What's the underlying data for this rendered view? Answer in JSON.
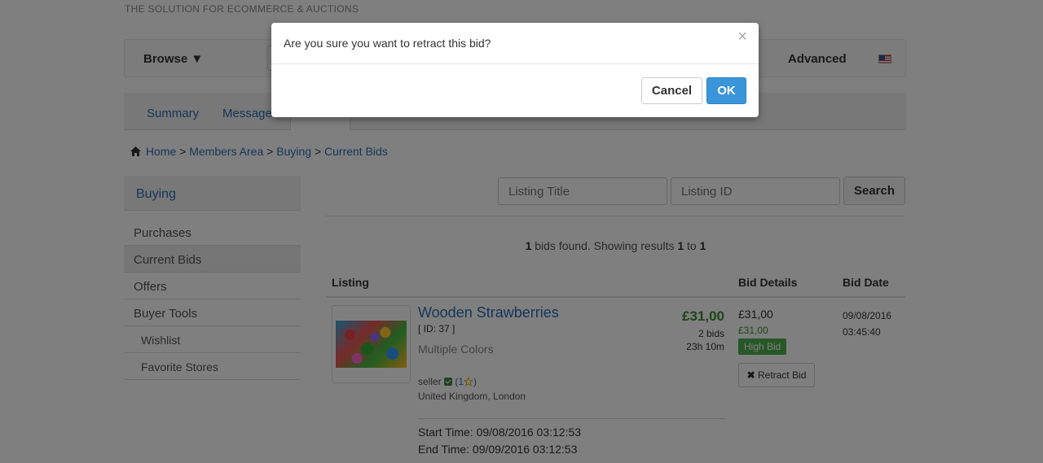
{
  "header": {
    "tagline": "THE SOLUTION FOR ECOMMERCE & AUCTIONS"
  },
  "navbar": {
    "browse": "Browse ▼",
    "advanced": "Advanced",
    "flag": "us-flag-icon"
  },
  "tabs": {
    "summary": "Summary",
    "messages": "Messages"
  },
  "breadcrumb": {
    "home": "Home",
    "members": "Members Area",
    "buying": "Buying",
    "current": "Current Bids",
    "sep": ">"
  },
  "sidebar": {
    "heading": "Buying",
    "items": [
      "Purchases",
      "Current Bids",
      "Offers",
      "Buyer Tools"
    ],
    "subitems": [
      "Wishlist",
      "Favorite Stores"
    ]
  },
  "filters": {
    "title_placeholder": "Listing Title",
    "id_placeholder": "Listing ID",
    "search": "Search"
  },
  "results": {
    "count": "1",
    "text1": "bids found. Showing results",
    "from": "1",
    "to_word": "to",
    "to": "1"
  },
  "table": {
    "headers": {
      "listing": "Listing",
      "bid_details": "Bid Details",
      "bid_date": "Bid Date"
    },
    "row": {
      "title": "Wooden Strawberries",
      "id": "[ ID: 37 ]",
      "variant": "Multiple Colors",
      "seller": "seller",
      "rating_open": "(1",
      "rating_close": ")",
      "location": "United Kingdom, London",
      "start": "Start Time: 09/08/2016 03:12:53",
      "end": "End Time: 09/09/2016 03:12:53",
      "price": "£31,00",
      "bids": "2 bids",
      "time_left": "23h 10m",
      "bid_amount": "£31,00",
      "bid_amount_max": "£31,00",
      "status": "High Bid",
      "retract": "Retract Bid",
      "date": "09/08/2016",
      "time": "03:45:40"
    }
  },
  "modal": {
    "message": "Are you sure you want to retract this bid?",
    "close": "×",
    "cancel": "Cancel",
    "ok": "OK"
  }
}
